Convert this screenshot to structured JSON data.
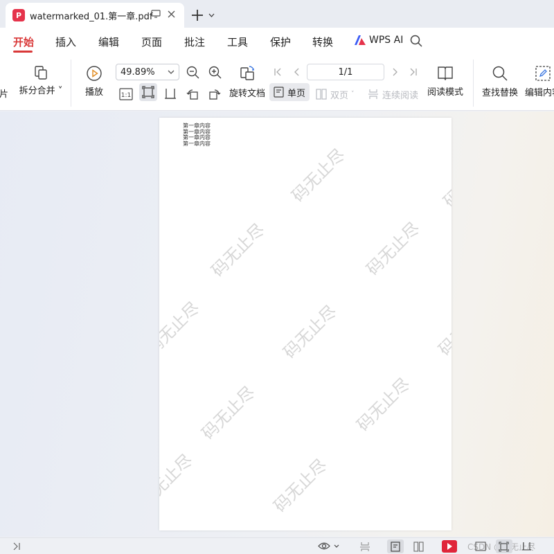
{
  "tab": {
    "title": "watermarked_01.第一章.pdf",
    "logo": "P"
  },
  "menu": {
    "items": [
      "开始",
      "插入",
      "编辑",
      "页面",
      "批注",
      "工具",
      "保护",
      "转换"
    ],
    "active": "开始",
    "ai_label": "WPS AI"
  },
  "toolbar": {
    "cut_left_label": "图片",
    "split_merge_label": "拆分合并",
    "play_label": "播放",
    "zoom_value": "49.89%",
    "rotate_doc_label": "旋转文档",
    "single_page_label": "单页",
    "double_page_label": "双页",
    "continuous_label": "连续阅读",
    "page_value": "1/1",
    "read_mode_label": "阅读模式",
    "find_replace_label": "查找替换",
    "edit_content_label": "编辑内容",
    "actual_size_label": "1:1"
  },
  "document": {
    "lines": [
      "第一章内容",
      "第一章内容",
      "第一章内容",
      "第一章内容"
    ],
    "watermark": "码无止尽"
  },
  "status": {
    "watermark_text": "CSDN @码无止尽"
  },
  "colors": {
    "accent": "#d93838",
    "pdf_logo": "#e5334b",
    "play_red": "#e0253a"
  }
}
